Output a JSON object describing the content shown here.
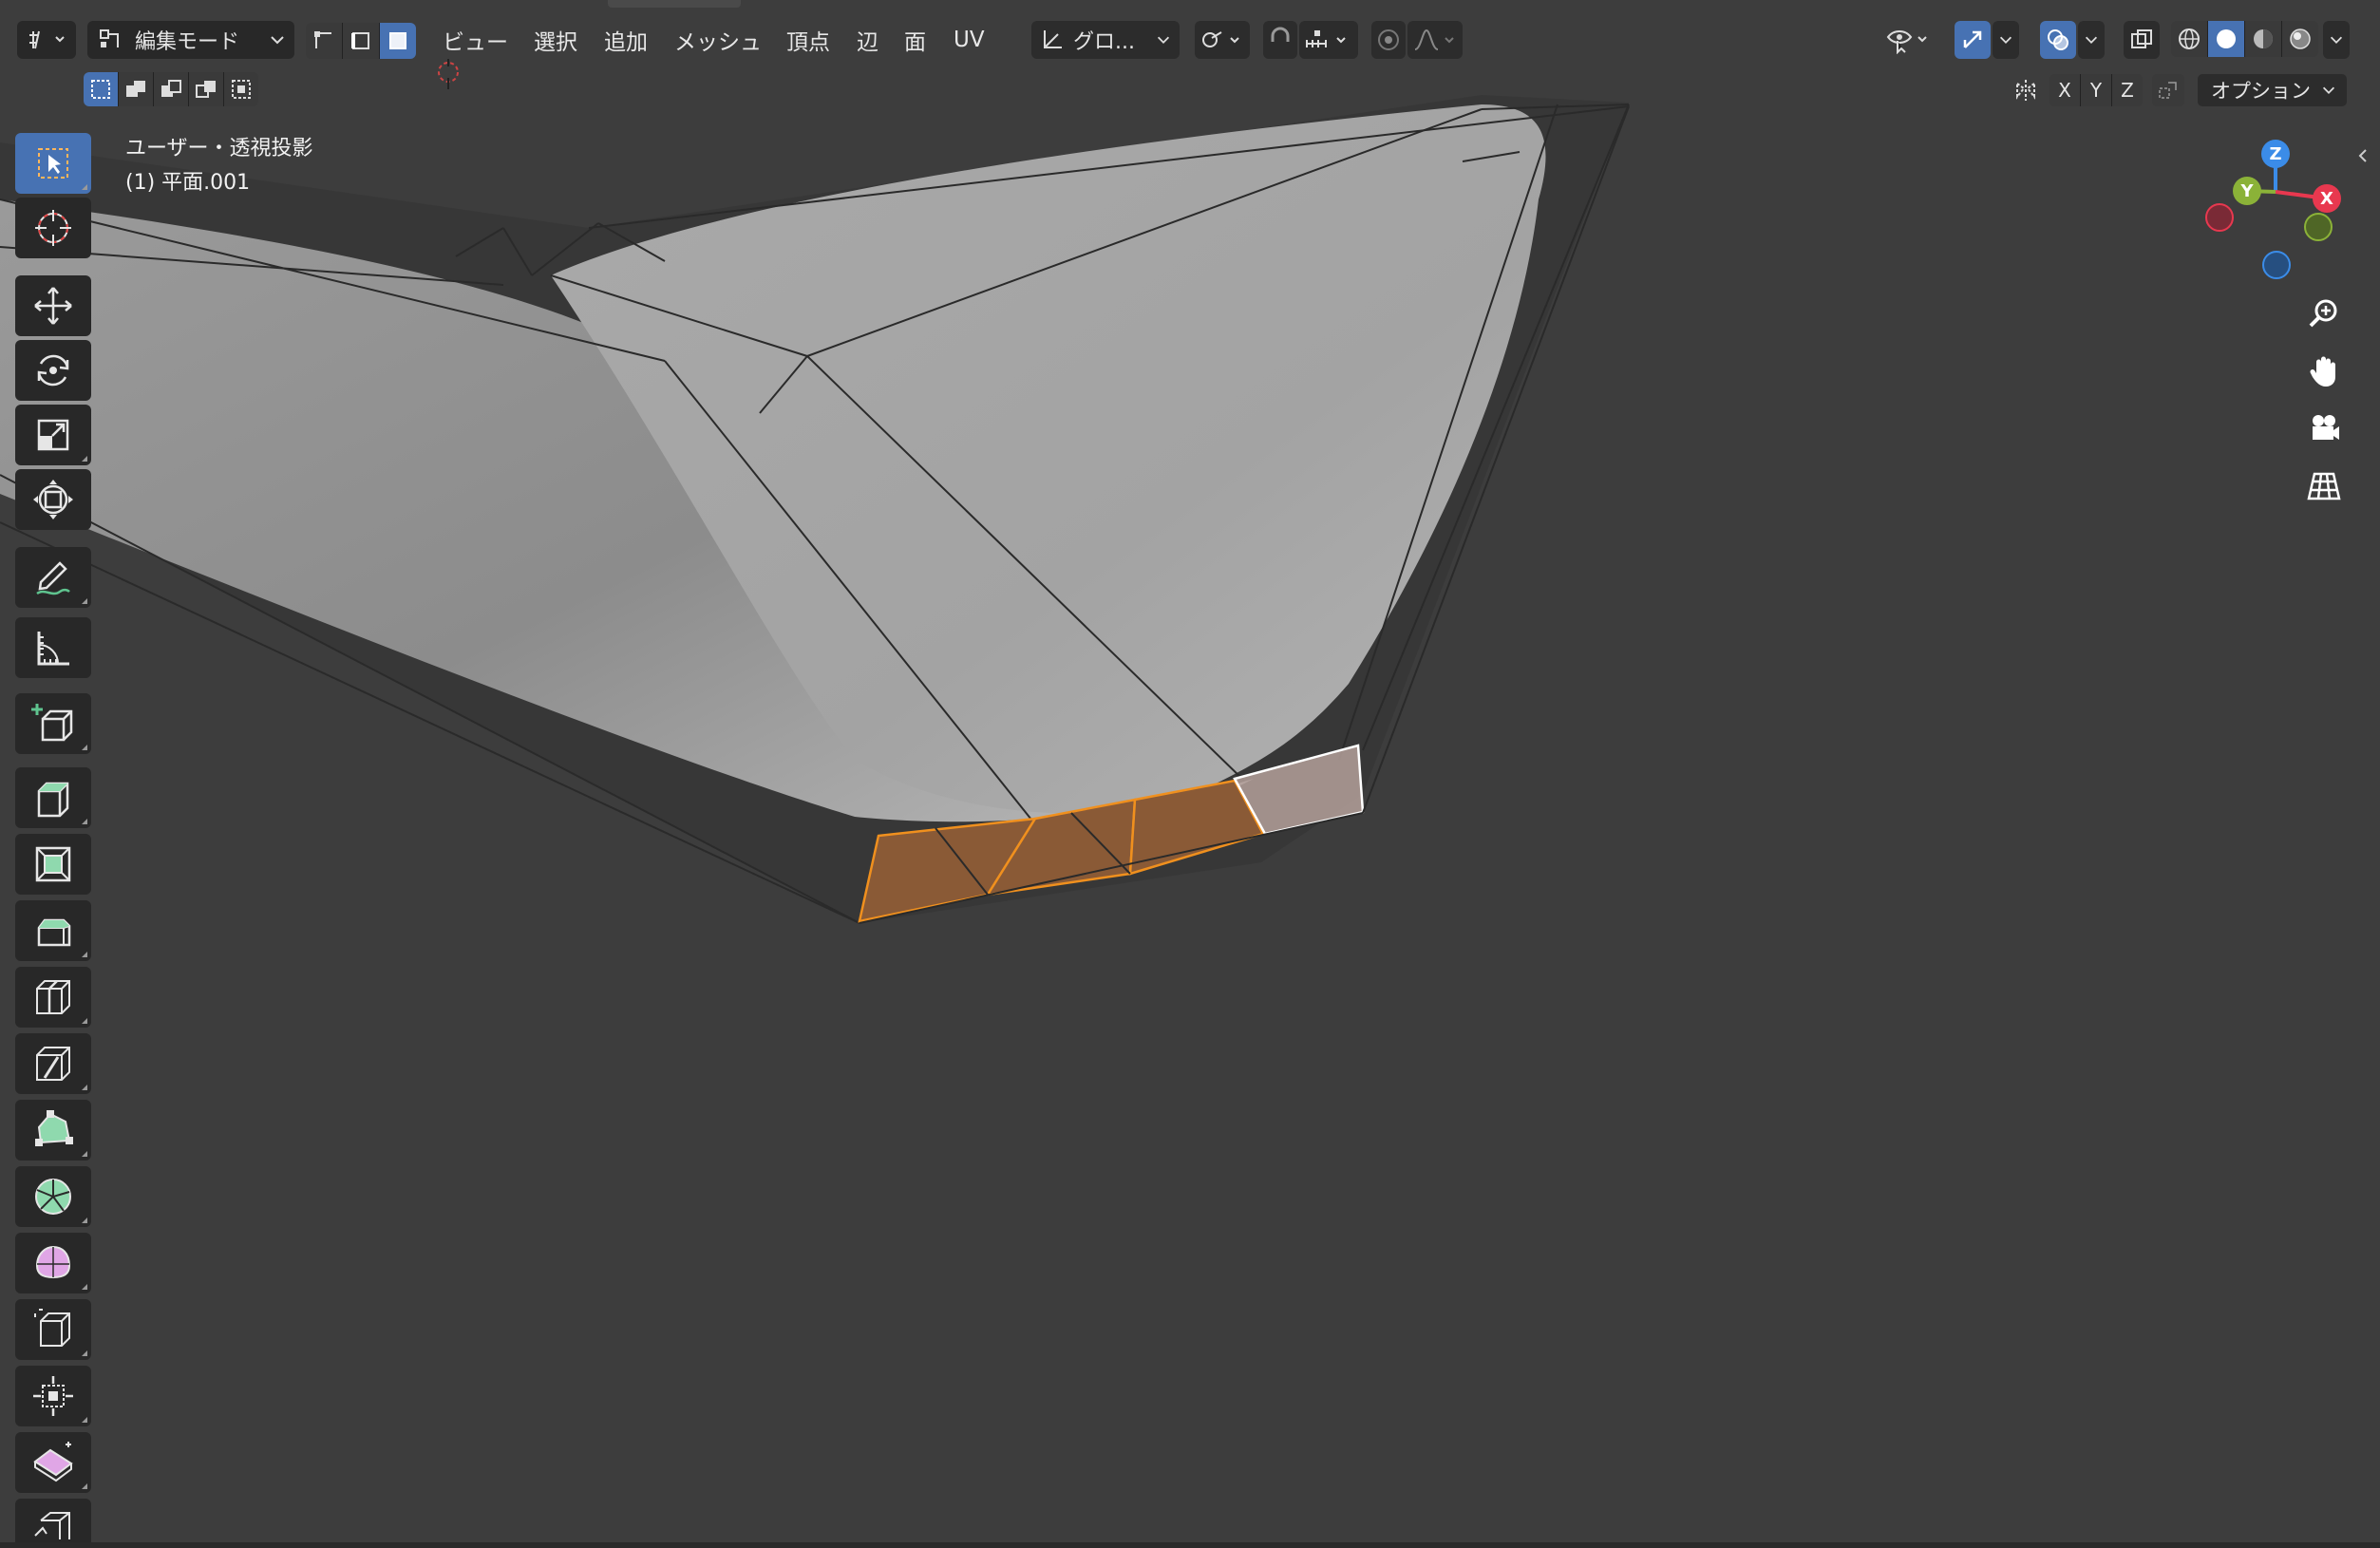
{
  "header": {
    "mode_label": "編集モード",
    "menus": [
      "ビュー",
      "選択",
      "追加",
      "メッシュ",
      "頂点",
      "辺",
      "面",
      "UV"
    ],
    "transform_orientation": "グロ...",
    "options_label": "オプション",
    "axis_toggles": [
      "X",
      "Y",
      "Z"
    ]
  },
  "viewport": {
    "view_name": "ユーザー・透視投影",
    "object_name": "(1) 平面.001"
  },
  "gizmo": {
    "x_label": "X",
    "y_label": "Y",
    "z_label": "Z",
    "x_color": "#e8384f",
    "y_color": "#8bb238",
    "z_color": "#3b8ce8"
  },
  "colors": {
    "bg": "#3d3d3d",
    "selected_face": "#c1712b",
    "selected_edge": "#f0901e",
    "active_face": "#ffffff",
    "mesh_surface": "#a5a5a5"
  },
  "toolbar": {
    "tools": [
      "select-box",
      "cursor",
      "move",
      "rotate",
      "scale",
      "transform",
      "annotate",
      "measure",
      "add-cube",
      "extrude-region",
      "inset-faces",
      "bevel",
      "loop-cut",
      "knife",
      "poly-build",
      "spin",
      "smooth",
      "edge-slide",
      "shrink-fatten",
      "shear",
      "rip-region"
    ]
  }
}
